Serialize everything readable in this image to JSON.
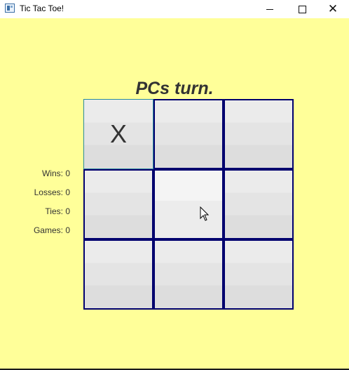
{
  "window": {
    "title": "Tic Tac Toe!",
    "icon": "app-window-icon",
    "controls": {
      "minimize": "minimize-icon",
      "maximize": "maximize-icon",
      "close": "close-icon"
    }
  },
  "status": {
    "turn_text": "PCs turn."
  },
  "stats": {
    "wins": "Wins: 0",
    "losses": "Losses: 0",
    "ties": "Ties: 0",
    "games": "Games: 0"
  },
  "board": {
    "cells": [
      "X",
      "",
      "",
      "",
      "",
      "",
      "",
      "",
      ""
    ]
  },
  "colors": {
    "background": "#ffff99",
    "cell_border": "#00006e",
    "text": "#333333"
  }
}
